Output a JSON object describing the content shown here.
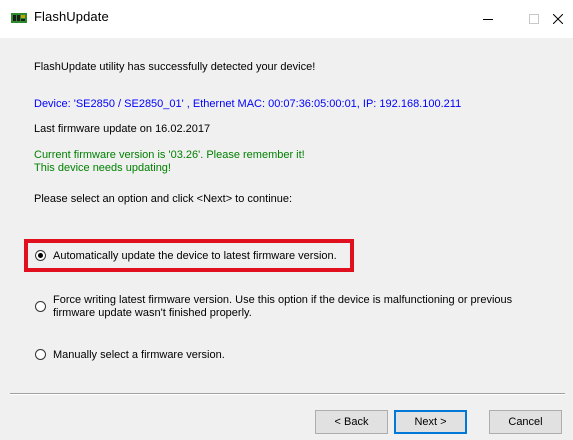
{
  "window": {
    "title": "FlashUpdate",
    "icon": "circuit-board-icon",
    "controls": {
      "minimize": "minimize-icon",
      "maximize": "maximize-icon",
      "close": "close-icon"
    }
  },
  "messages": {
    "detected": "FlashUpdate utility has successfully detected your device!",
    "device_info": "Device: 'SE2850 / SE2850_01' , Ethernet MAC: 00:07:36:05:00:01, IP: 192.168.100.211",
    "last_update": "Last firmware update on 16.02.2017",
    "current_version": "Current firmware version is '03.26'. Please remember it!",
    "needs_update": "This device needs updating!",
    "instruction": "Please select an option and click <Next> to continue:"
  },
  "options": [
    {
      "label": "Automatically update the device to latest firmware version.",
      "checked": true
    },
    {
      "label_line1": "Force writing latest firmware version. Use this option if the device is malfunctioning or previous",
      "label_line2": "firmware update wasn't finished properly.",
      "checked": false
    },
    {
      "label": "Manually select a firmware version.",
      "checked": false
    }
  ],
  "buttons": {
    "back": "< Back",
    "next": "Next >",
    "cancel": "Cancel"
  },
  "colors": {
    "info_blue": "#0000ff",
    "status_green": "#008000",
    "highlight_red": "#e0101e",
    "accent": "#0078d7"
  }
}
